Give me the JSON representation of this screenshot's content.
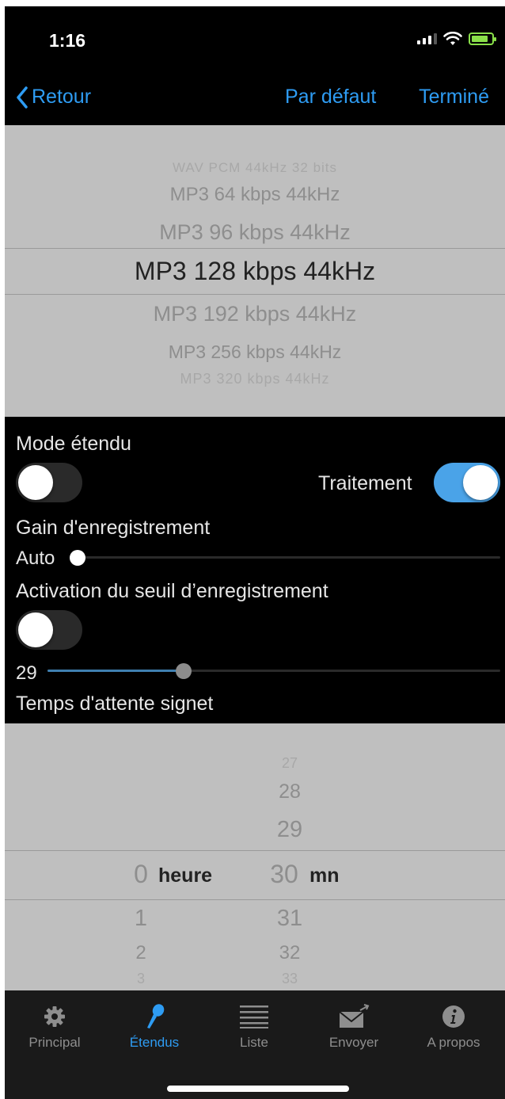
{
  "status_bar": {
    "time": "1:16"
  },
  "nav": {
    "back_label": "Retour",
    "default_label": "Par défaut",
    "done_label": "Terminé"
  },
  "format_picker": {
    "items": [
      "WAV PCM 44kHz 32 bits",
      "MP3 64 kbps 44kHz",
      "MP3 96 kbps 44kHz",
      "MP3 128 kbps 44kHz",
      "MP3 192 kbps 44kHz",
      "MP3 256 kbps 44kHz",
      "MP3 320 kbps 44kHz"
    ],
    "selected_index": 3
  },
  "settings": {
    "extended_mode_label": "Mode étendu",
    "extended_mode_on": false,
    "processing_label": "Traitement",
    "processing_on": true,
    "gain_label": "Gain d'enregistrement",
    "gain_value": "Auto",
    "gain_level": 0,
    "threshold_label": "Activation du seuil d’enregistrement",
    "threshold_on": false,
    "threshold_value": "29",
    "threshold_level": 0.3,
    "bookmark_label": "Temps d'attente signet"
  },
  "time_picker": {
    "hours": [
      "0",
      "1",
      "2",
      "3"
    ],
    "hour_unit": "heure",
    "minutes": [
      "27",
      "28",
      "29",
      "30",
      "31",
      "32",
      "33"
    ],
    "minute_unit": "mn",
    "selected_hour": "0",
    "selected_minute": "30"
  },
  "tabs": [
    {
      "label": "Principal",
      "icon": "gear-icon",
      "active": false
    },
    {
      "label": "Étendus",
      "icon": "microphone-icon",
      "active": true
    },
    {
      "label": "Liste",
      "icon": "list-icon",
      "active": false
    },
    {
      "label": "Envoyer",
      "icon": "send-mail-icon",
      "active": false
    },
    {
      "label": "A propos",
      "icon": "info-icon",
      "active": false
    }
  ],
  "colors": {
    "accent": "#2e9cf3",
    "toggle_on": "#4aa3e8",
    "picker_bg": "#bfbfbf"
  }
}
